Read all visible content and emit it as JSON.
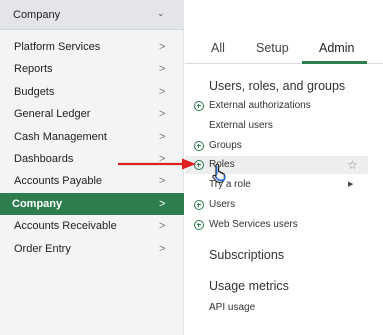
{
  "company_select": {
    "label": "Company",
    "chevron": "chevron-down-icon"
  },
  "menu": {
    "items": [
      {
        "label": "Platform Services",
        "active": false
      },
      {
        "label": "Reports",
        "active": false
      },
      {
        "label": "Budgets",
        "active": false
      },
      {
        "label": "General Ledger",
        "active": false
      },
      {
        "label": "Cash Management",
        "active": false
      },
      {
        "label": "Dashboards",
        "active": false
      },
      {
        "label": "Accounts Payable",
        "active": false
      },
      {
        "label": "Company",
        "active": true
      },
      {
        "label": "Accounts Receivable",
        "active": false
      },
      {
        "label": "Order Entry",
        "active": false
      }
    ],
    "arrow_glyph": ">"
  },
  "tabs": [
    {
      "label": "All",
      "active": false
    },
    {
      "label": "Setup",
      "active": false
    },
    {
      "label": "Admin",
      "active": true
    }
  ],
  "sections": {
    "users_roles_groups": {
      "heading": "Users, roles, and groups",
      "items": [
        {
          "label": "External authorizations",
          "has_add": true
        },
        {
          "label": "External users",
          "has_add": false
        },
        {
          "label": "Groups",
          "has_add": true
        },
        {
          "label": "Roles",
          "has_add": true,
          "hovered": true,
          "star": "☆"
        },
        {
          "label": "Try a role",
          "has_add": false,
          "submenu": "▶"
        },
        {
          "label": "Users",
          "has_add": true
        },
        {
          "label": "Web Services users",
          "has_add": true
        }
      ]
    },
    "subscriptions": {
      "heading": "Subscriptions"
    },
    "usage_metrics": {
      "heading": "Usage metrics",
      "items": [
        {
          "label": "API usage",
          "has_add": false
        }
      ]
    }
  },
  "colors": {
    "accent": "#2e7d4f",
    "annotation_arrow": "#e02020",
    "sidebar_bg": "#f3f4f5"
  }
}
